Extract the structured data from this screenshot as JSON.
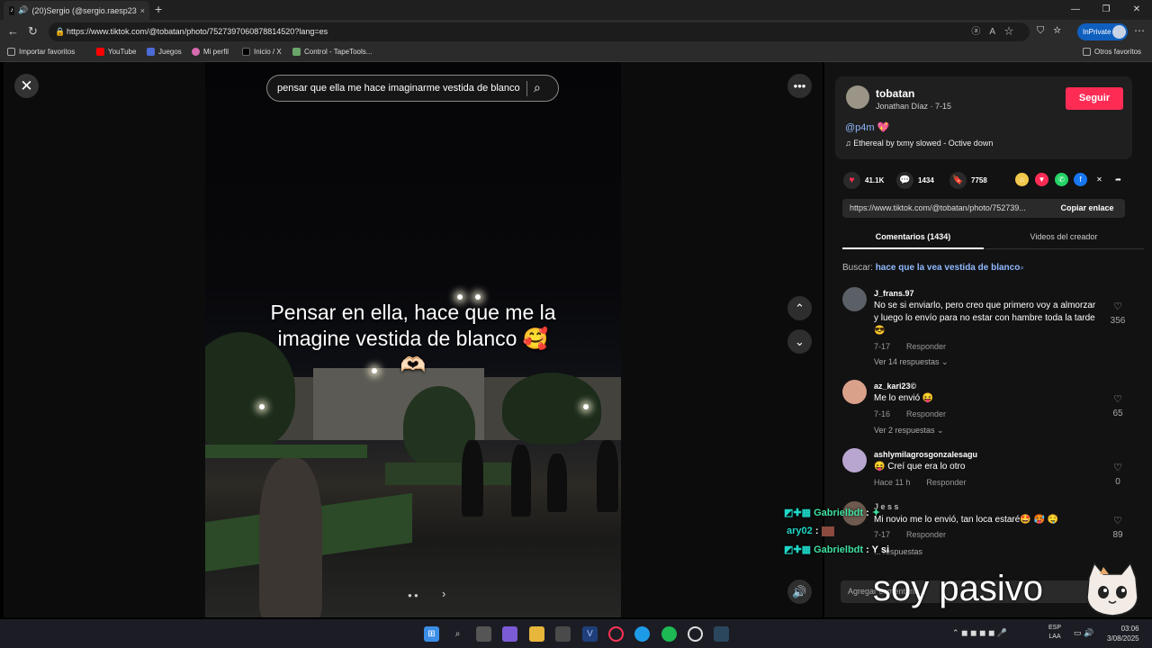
{
  "browser": {
    "tab_title": "(20)Sergio (@sergio.raesp23",
    "tab_close": "×",
    "new_tab": "+",
    "url": "https://www.tiktok.com/@tobatan/photo/7527397060878814520?lang=es",
    "inprivate": "InPrivate",
    "bookmarks": [
      "Importar favoritos",
      "YouTube",
      "Juegos",
      "Mi perfil",
      "Inicio / X",
      "Control - TapeTools..."
    ],
    "other_bookmarks": "Otros favoritos"
  },
  "viewer": {
    "search_query": "pensar que ella me hace imaginarme vestida de blanco",
    "caption": "Pensar en ella, hace que me la imagine vestida de blanco 🥰🫶🏻"
  },
  "post": {
    "author": "tobatan",
    "subline": "Jonathan Díaz · 7-15",
    "follow": "Seguir",
    "mention": "@p4m 💖",
    "music": "Ethereal by txmy slowed - Octive down",
    "likes": "41.1K",
    "comments": "1434",
    "saves": "7758",
    "link": "https://www.tiktok.com/@tobatan/photo/752739...",
    "copy_link": "Copiar enlace",
    "tab_comments": "Comentarios (1434)",
    "tab_creator": "Videos del creador",
    "search_label": "Buscar:",
    "search_term": "hace que la vea vestida de blanco"
  },
  "comments": [
    {
      "user": "J_frans.97",
      "text": "No se si enviarlo, pero creo que primero voy a almorzar y luego lo envío para no estar con hambre toda la tarde 😎",
      "date": "7-17",
      "reply": "Responder",
      "replies": "Ver 14 respuestas ⌄",
      "likes": "356",
      "avatar_color": "#5b5f66"
    },
    {
      "user": "az_kari23©",
      "text": "Me lo envió 😝",
      "date": "7-16",
      "reply": "Responder",
      "replies": "Ver 2 respuestas ⌄",
      "likes": "65",
      "avatar_color": "#d9a08a"
    },
    {
      "user": "ashlymilagrosgonzalesagu",
      "text": "😝 Creí que era lo otro",
      "date": "Hace 11 h",
      "reply": "Responder",
      "replies": "",
      "likes": "0",
      "avatar_color": "#b8a6d0"
    },
    {
      "user": "J e s s",
      "text": "Mi novio me lo envió, tan loca estaré🤩 🥵 🤤",
      "date": "7-17",
      "reply": "Responder",
      "replies": "... respuestas",
      "likes": "89",
      "avatar_color": "#6e5a4e"
    }
  ],
  "chat": [
    {
      "user": "Gabrielbdt",
      "msg": ":"
    },
    {
      "user": "ary02",
      "msg": ":"
    },
    {
      "user": "Gabrielbdt",
      "msg": ": Y si"
    }
  ],
  "add_comment_placeholder": "Agregar comentario...",
  "overlay_text": "soy pasivo",
  "taskbar": {
    "lang_top": "ESP",
    "lang_bottom": "LAA",
    "time": "03:06",
    "date": "3/08/2025"
  }
}
